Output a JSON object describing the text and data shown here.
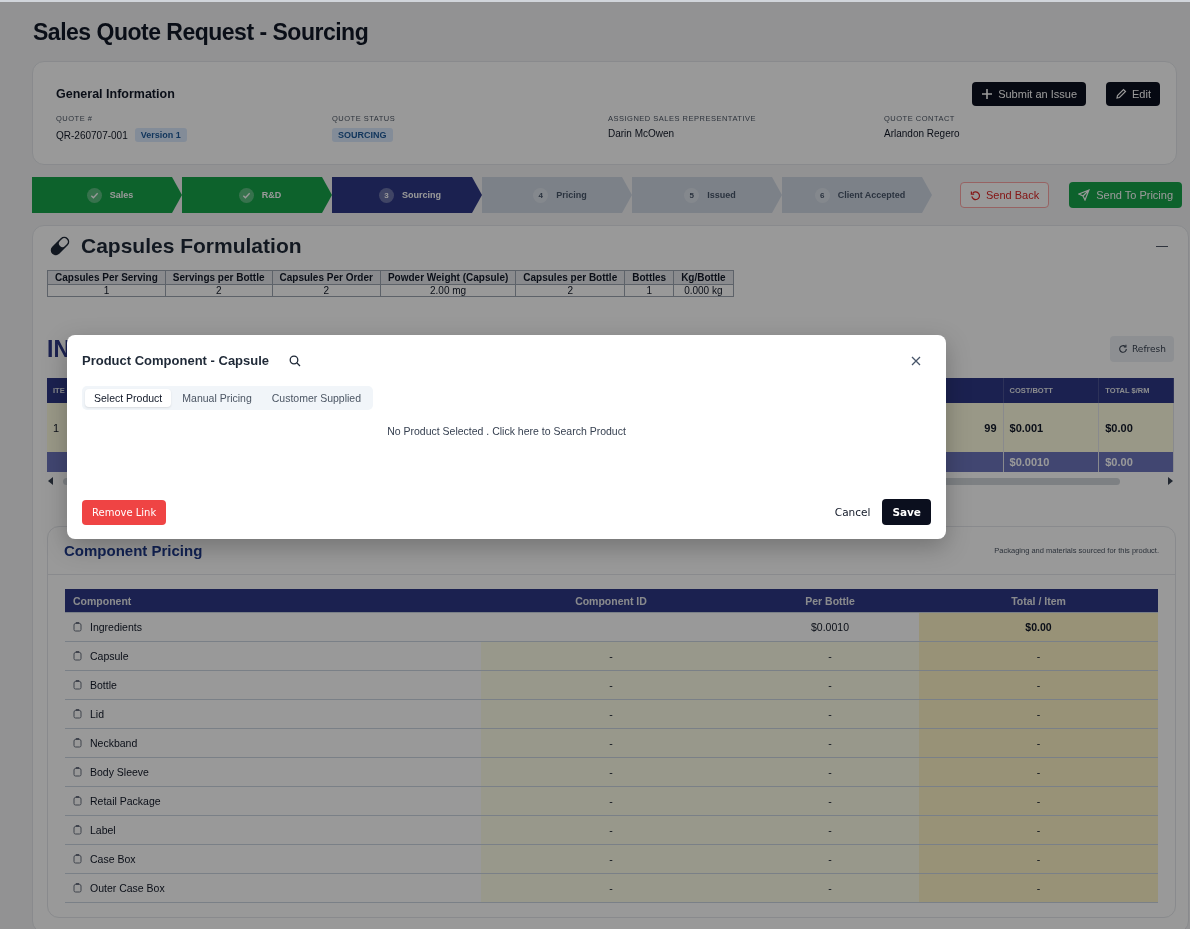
{
  "page": {
    "title": "Sales Quote Request - Sourcing"
  },
  "general_information": {
    "title": "General Information",
    "actions": [
      {
        "kind": "plus",
        "label": "Submit an Issue"
      },
      {
        "kind": "pencil",
        "label": "Edit"
      }
    ],
    "fields": [
      {
        "label": "QUOTE #",
        "value": "QR-260707-001",
        "badge": "Version 1",
        "kind": "text"
      },
      {
        "label": "QUOTE STATUS",
        "value": "SOURCING",
        "kind": "status"
      },
      {
        "label": "ASSIGNED SALES REPRESENTATIVE",
        "value": "Darin McOwen",
        "kind": "text"
      },
      {
        "label": "QUOTE CONTACT",
        "value": "Arlandon Regero",
        "kind": "text"
      }
    ]
  },
  "stepper": {
    "steps": [
      {
        "label": "Sales",
        "completed": true,
        "selected": false
      },
      {
        "label": "R&D",
        "completed": true,
        "selected": false
      },
      {
        "number": "3",
        "label": "Sourcing",
        "completed": false,
        "selected": true
      },
      {
        "number": "4",
        "label": "Pricing",
        "completed": false,
        "selected": false
      },
      {
        "number": "5",
        "label": "Issued",
        "completed": false,
        "selected": false
      },
      {
        "number": "6",
        "label": "Client Accepted",
        "completed": false,
        "selected": false
      }
    ],
    "actions": [
      {
        "kind": "back",
        "label": "Send Back"
      },
      {
        "kind": "send",
        "label": "Send To Pricing"
      }
    ]
  },
  "formulation": {
    "title": "Capsules Formulation",
    "collapse": "—",
    "columns": [
      "Capsules Per Serving",
      "Servings per Bottle",
      "Capsules Per Order",
      "Powder Weight (Capsule)",
      "Capsules per Bottle",
      "Bottles",
      "Kg/Bottle"
    ],
    "row": {
      "capsules_per_serving": "1",
      "servings_per_bottle": "2",
      "capsules_per_order": "2",
      "powder_weight": "2.00 mg",
      "capsules_per_bottle": "2",
      "bottles": "1",
      "kg_per_bottle": "0.000 kg"
    }
  },
  "ingredients": {
    "title": "IN",
    "refresh": "Refresh",
    "columns": [
      "ITE",
      "",
      "COST/BOTT",
      "TOTAL $/RM"
    ],
    "row": {
      "item": "1",
      "column_3": "99",
      "cost_per_bottle": "$0.001",
      "total_per_rm": "$0.00"
    },
    "total_row": [
      "$0.0010",
      "$0.00"
    ]
  },
  "component_pricing": {
    "title": "Component Pricing",
    "note": "Packaging and materials sourced for this product.",
    "columns": [
      "Component",
      "Component ID",
      "Per Bottle",
      "Total / Item"
    ],
    "rows": [
      {
        "kind": "summary",
        "name": "Ingredients",
        "per_bottle": "$0.0010",
        "total": "$0.00"
      },
      {
        "kind": "item",
        "name": "Capsule",
        "component_id": "-",
        "per_bottle": "-",
        "total": "-"
      },
      {
        "kind": "item",
        "name": "Bottle",
        "component_id": "-",
        "per_bottle": "-",
        "total": "-"
      },
      {
        "kind": "item",
        "name": "Lid",
        "component_id": "-",
        "per_bottle": "-",
        "total": "-"
      },
      {
        "kind": "item",
        "name": "Neckband",
        "component_id": "-",
        "per_bottle": "-",
        "total": "-"
      },
      {
        "kind": "item",
        "name": "Body Sleeve",
        "component_id": "-",
        "per_bottle": "-",
        "total": "-"
      },
      {
        "kind": "item",
        "name": "Retail Package",
        "component_id": "-",
        "per_bottle": "-",
        "total": "-"
      },
      {
        "kind": "item",
        "name": "Label",
        "component_id": "-",
        "per_bottle": "-",
        "total": "-"
      },
      {
        "kind": "item",
        "name": "Case Box",
        "component_id": "-",
        "per_bottle": "-",
        "total": "-"
      },
      {
        "kind": "item",
        "name": "Outer Case Box",
        "component_id": "-",
        "per_bottle": "-",
        "total": "-"
      }
    ]
  },
  "modal": {
    "title": "Product Component - Capsule",
    "tabs": [
      {
        "label": "Select Product",
        "selected": true
      },
      {
        "label": "Manual Pricing",
        "selected": false
      },
      {
        "label": "Customer Supplied",
        "selected": false
      }
    ],
    "message": "No Product Selected . Click here to Search Product",
    "remove_button": "Remove Link",
    "cancel_button": "Cancel",
    "save_button": "Save"
  }
}
